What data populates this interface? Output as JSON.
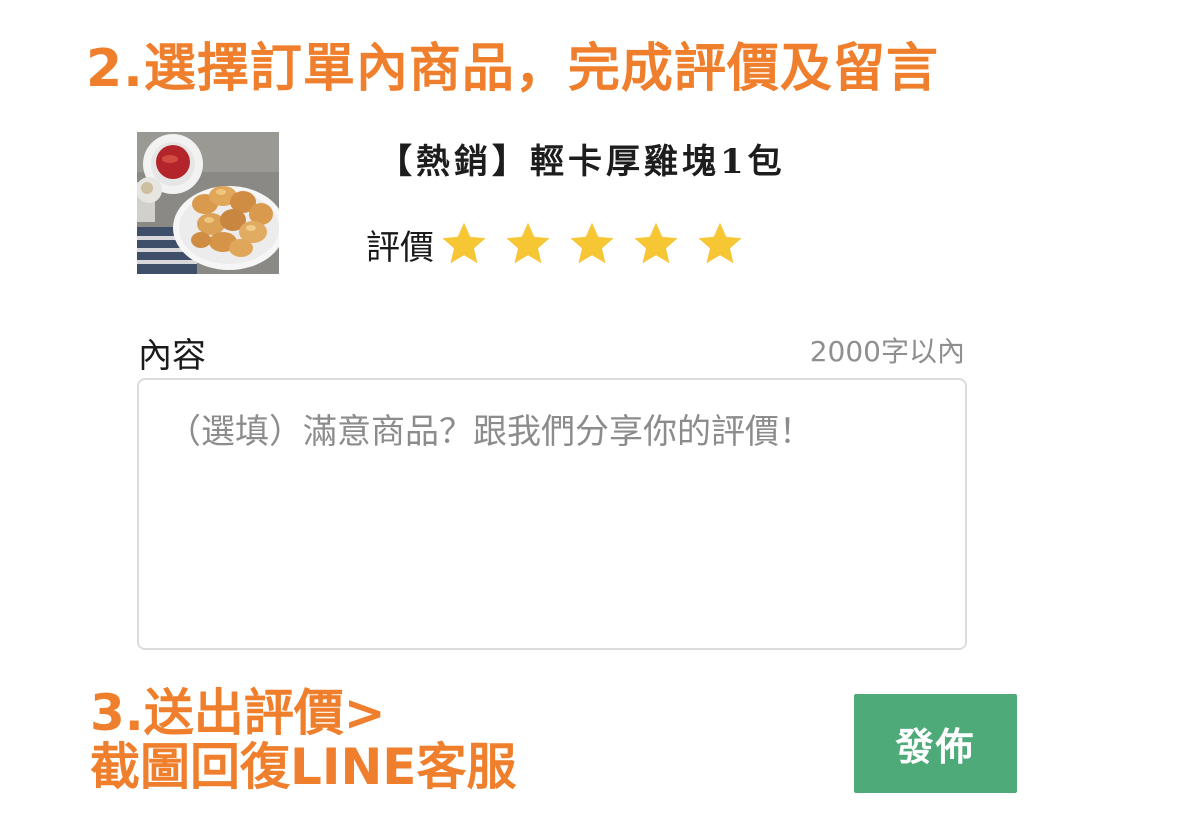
{
  "guide": {
    "step2_title": "2.選擇訂單內商品，完成評價及留言",
    "step3_line1": "3.送出評價>",
    "step3_line2": "截圖回復LINE客服"
  },
  "product": {
    "name": "【熱銷】輕卡厚雞塊1包",
    "image_icon": "chicken-nuggets-photo"
  },
  "rating": {
    "label": "評價",
    "value": 5,
    "max": 5,
    "star_color": "#f7c634"
  },
  "review": {
    "content_label": "內容",
    "char_limit": "2000字以內",
    "value": "",
    "placeholder": "（選填）滿意商品？跟我們分享你的評價！"
  },
  "actions": {
    "publish_label": "發佈"
  },
  "colors": {
    "accent_orange": "#ef7f2c",
    "button_green": "#4eaa79"
  }
}
